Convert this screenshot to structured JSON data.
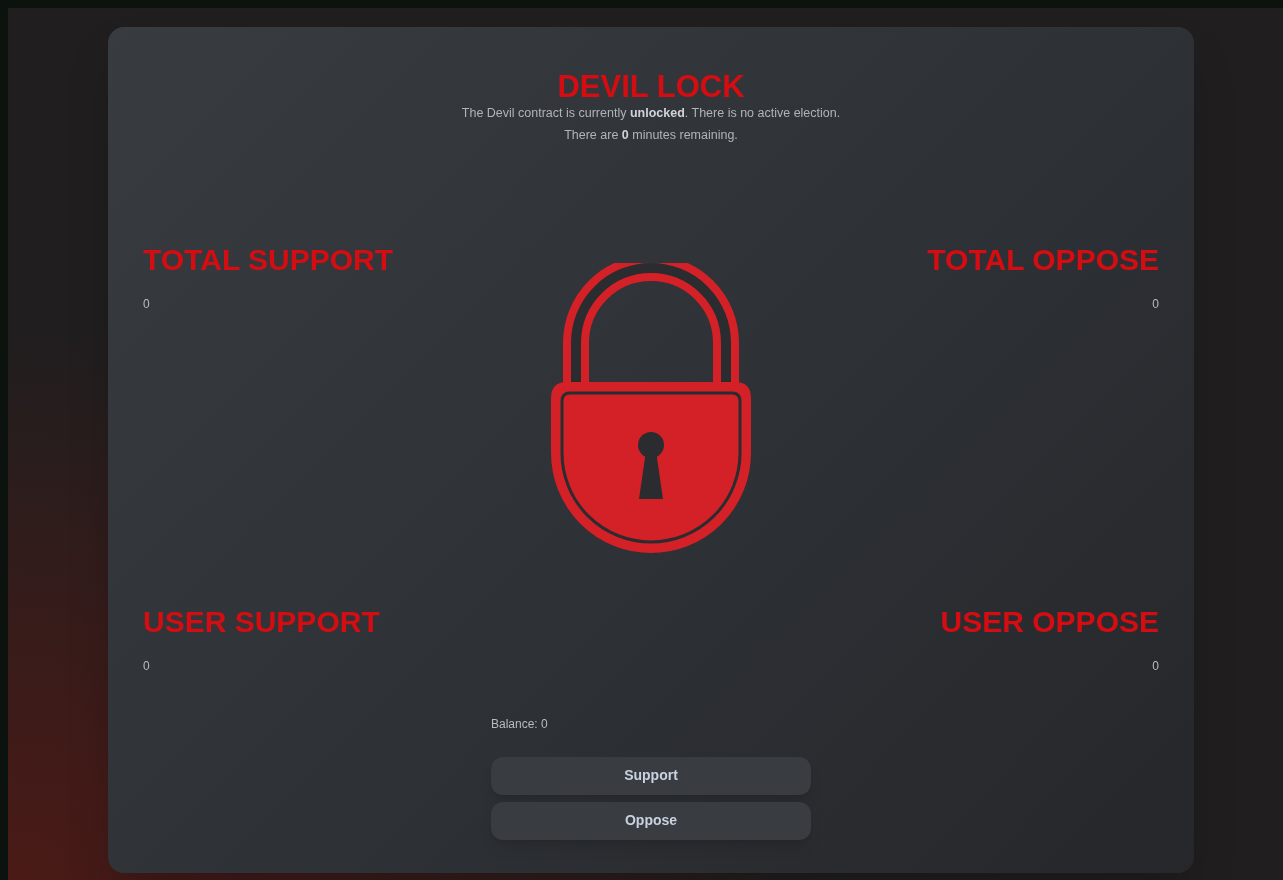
{
  "title": "DEVIL LOCK",
  "status_lines": [
    "The Devil contract is currently **unlocked**. There is no active election.",
    "There are **0** minutes remaining."
  ],
  "stat_rows": [
    {
      "left": {
        "label": "TOTAL SUPPORT",
        "value": "0"
      },
      "right": {
        "label": "TOTAL OPPOSE",
        "value": "0"
      }
    },
    {
      "left": {
        "label": "USER SUPPORT",
        "value": "0"
      },
      "right": {
        "label": "USER OPPOSE",
        "value": "0"
      }
    }
  ],
  "balance": "Balance: 0",
  "buttons": [
    "Support",
    "Oppose"
  ]
}
